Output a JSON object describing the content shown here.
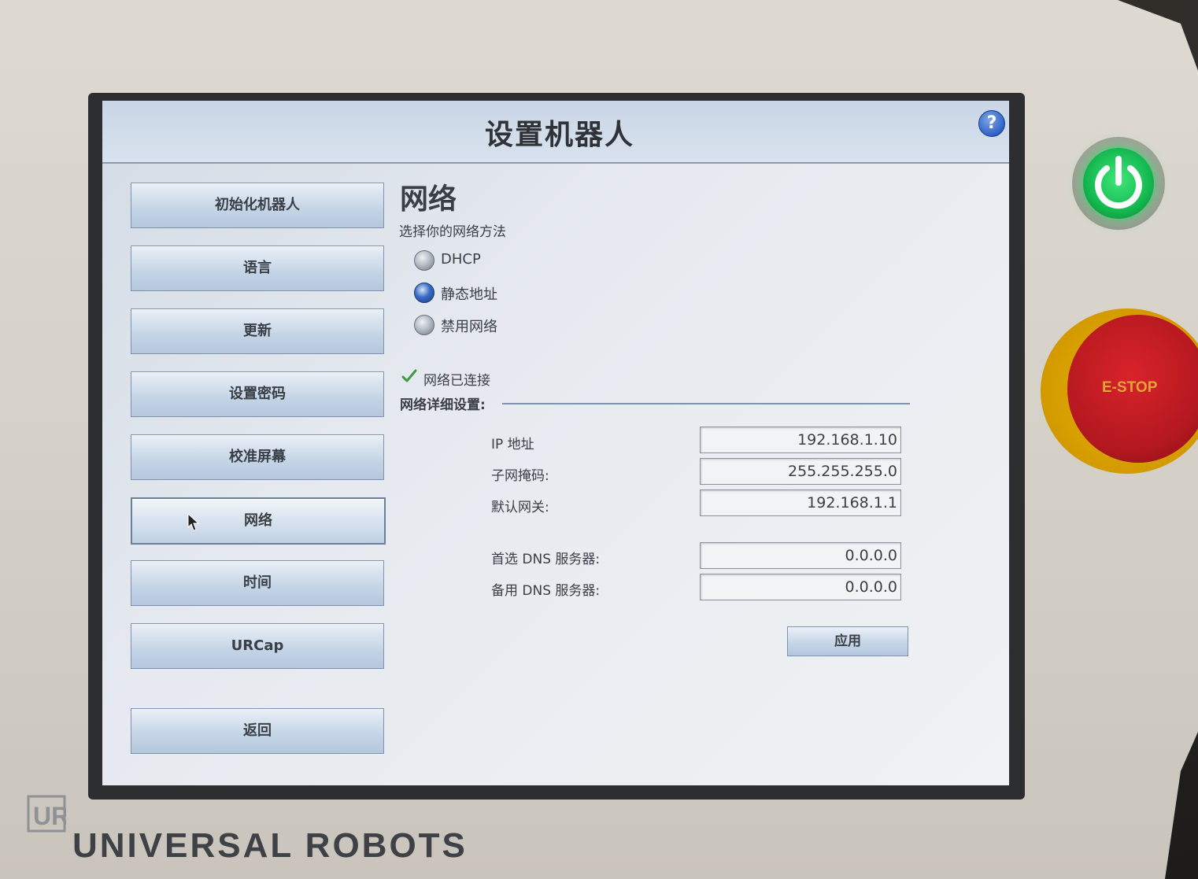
{
  "header": {
    "title": "设置机器人",
    "help_label": "?"
  },
  "sidebar": {
    "items": [
      {
        "label": "初始化机器人"
      },
      {
        "label": "语言"
      },
      {
        "label": "更新"
      },
      {
        "label": "设置密码"
      },
      {
        "label": "校准屏幕"
      },
      {
        "label": "网络",
        "active": true
      },
      {
        "label": "时间"
      },
      {
        "label": "URCap"
      }
    ],
    "back_label": "返回"
  },
  "network": {
    "section_title": "网络",
    "method_prompt": "选择你的网络方法",
    "methods": [
      {
        "label": "DHCP",
        "selected": false
      },
      {
        "label": "静态地址",
        "selected": true
      },
      {
        "label": "禁用网络",
        "selected": false
      }
    ],
    "status": "网络已连接",
    "details_label": "网络详细设置:",
    "fields": [
      {
        "label": "IP 地址",
        "value": "192.168.1.10"
      },
      {
        "label": "子网掩码:",
        "value": "255.255.255.0"
      },
      {
        "label": "默认网关:",
        "value": "192.168.1.1"
      },
      {
        "label": "首选 DNS 服务器:",
        "value": "0.0.0.0"
      },
      {
        "label": "备用 DNS 服务器:",
        "value": "0.0.0.0"
      }
    ],
    "apply_label": "应用"
  },
  "hardware": {
    "estop_label": "E-STOP",
    "brand": "UNIVERSAL ROBOTS",
    "logo_text": "UR"
  },
  "colors": {
    "power_green": "#14b84f",
    "estop_red": "#b3181f",
    "estop_yellow": "#d39a00",
    "radio_selected": "#3a6cc4"
  }
}
